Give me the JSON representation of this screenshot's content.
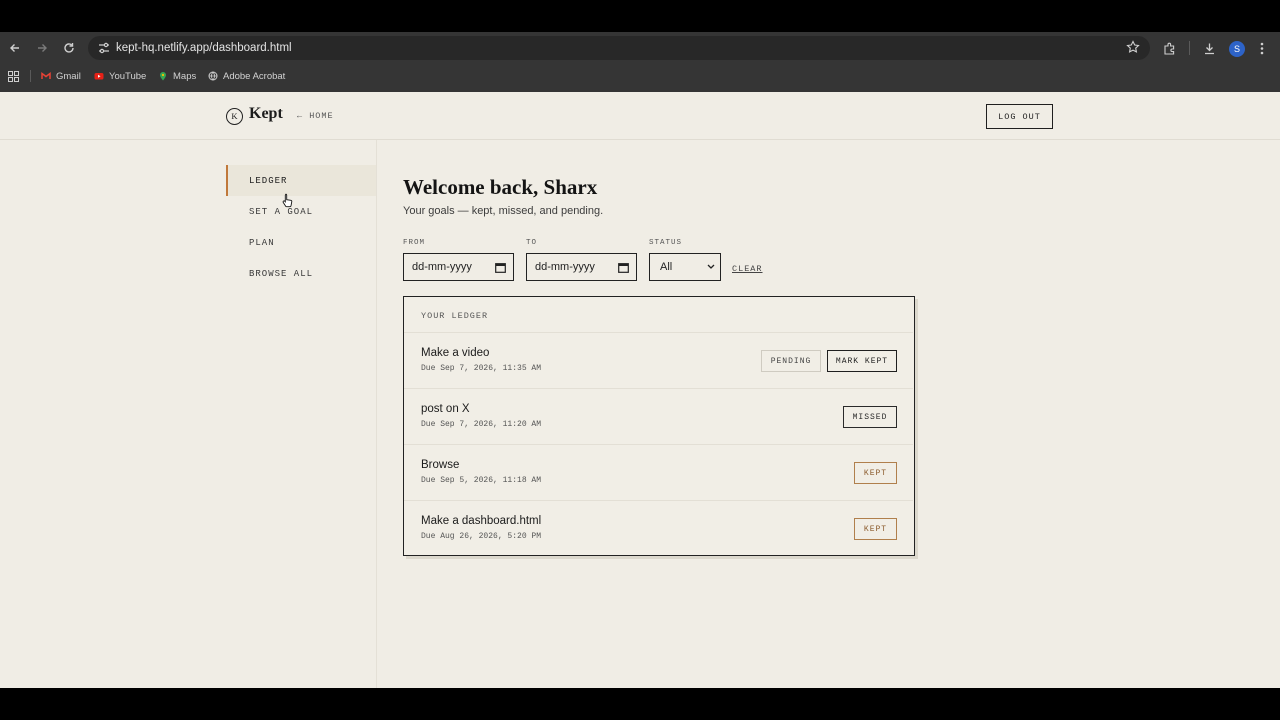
{
  "browser": {
    "url": "kept-hq.netlify.app/dashboard.html",
    "avatar_letter": "S",
    "bookmarks": [
      "Gmail",
      "YouTube",
      "Maps",
      "Adobe Acrobat"
    ]
  },
  "header": {
    "logo_mark": "K",
    "logo_text": "Kept",
    "home_link": "← HOME",
    "logout": "LOG OUT"
  },
  "sidebar": {
    "items": [
      {
        "label": "LEDGER",
        "active": true
      },
      {
        "label": "SET A GOAL",
        "active": false
      },
      {
        "label": "PLAN",
        "active": false
      },
      {
        "label": "BROWSE ALL",
        "active": false
      }
    ]
  },
  "main": {
    "welcome": "Welcome back, Sharx",
    "subtitle": "Your goals — kept, missed, and pending."
  },
  "filters": {
    "from_label": "FROM",
    "from_placeholder": "dd-mm-yyyy",
    "to_label": "TO",
    "to_placeholder": "dd-mm-yyyy",
    "status_label": "STATUS",
    "status_value": "All",
    "clear": "CLEAR"
  },
  "ledger": {
    "title": "YOUR LEDGER",
    "rows": [
      {
        "title": "Make a video",
        "due": "Due Sep 7, 2026, 11:35 AM",
        "status": "PENDING",
        "action": "MARK KEPT"
      },
      {
        "title": "post on X",
        "due": "Due Sep 7, 2026, 11:20 AM",
        "status": "MISSED"
      },
      {
        "title": "Browse",
        "due": "Due Sep 5, 2026, 11:18 AM",
        "status": "KEPT"
      },
      {
        "title": "Make a dashboard.html",
        "due": "Due Aug 26, 2026, 5:20 PM",
        "status": "KEPT"
      }
    ]
  },
  "colors": {
    "page_bg": "#f0ede5",
    "accent": "#c0783a",
    "kept": "#b07f4c",
    "text": "#1b1b1b"
  }
}
